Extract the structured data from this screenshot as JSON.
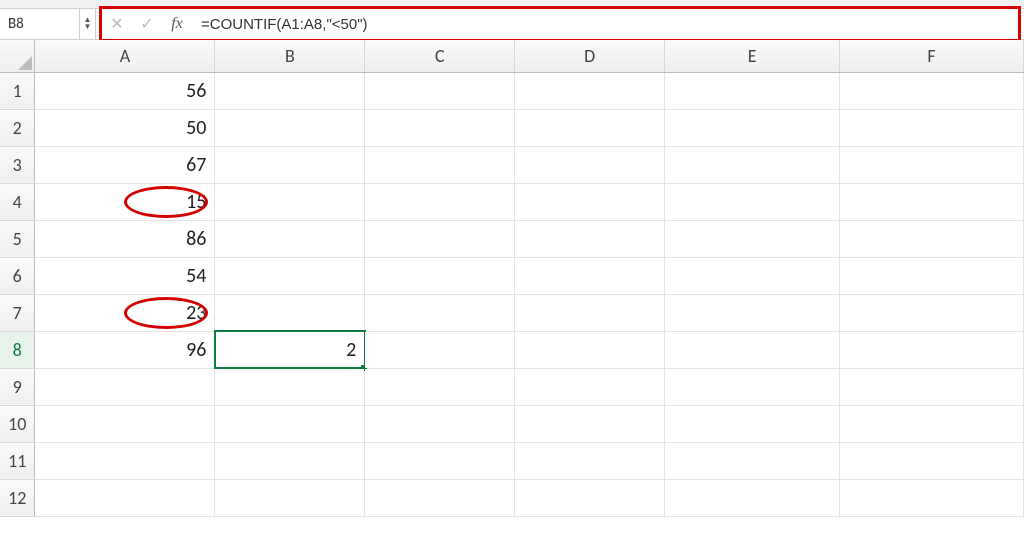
{
  "formula_bar": {
    "active_cell": "B8",
    "formula": "=COUNTIF(A1:A8,\"<50\")",
    "fx_label": "fx"
  },
  "columns": [
    "A",
    "B",
    "C",
    "D",
    "E",
    "F"
  ],
  "rows": [
    "1",
    "2",
    "3",
    "4",
    "5",
    "6",
    "7",
    "8",
    "9",
    "10",
    "11",
    "12"
  ],
  "cells": {
    "A1": "56",
    "A2": "50",
    "A3": "67",
    "A4": "15",
    "A5": "86",
    "A6": "54",
    "A7": "23",
    "A8": "96",
    "B8": "2"
  },
  "selected_cell": "B8",
  "circled_cells": [
    "A4",
    "A7"
  ]
}
